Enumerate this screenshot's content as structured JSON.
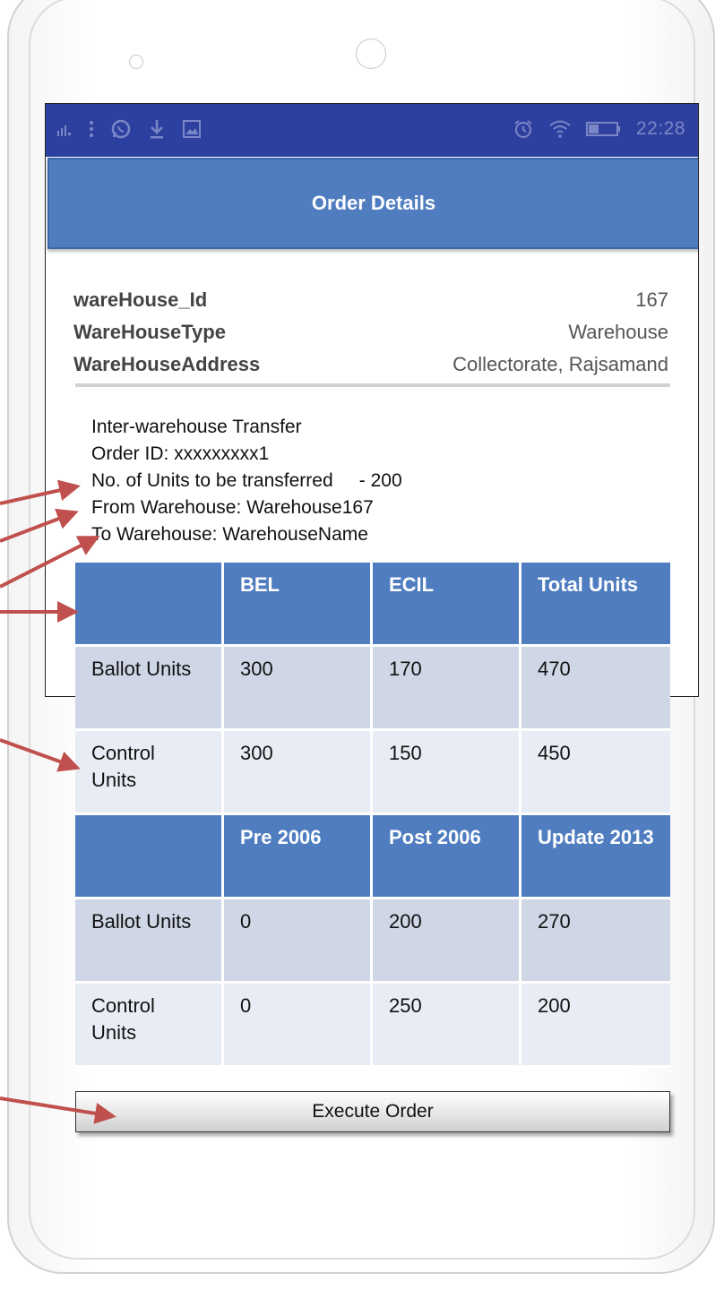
{
  "status_bar": {
    "time": "22:28",
    "left_icons": [
      "signal-icon",
      "more-icon",
      "whatsapp-icon",
      "download-icon",
      "image-icon"
    ],
    "right_icons": [
      "alarm-icon",
      "wifi-icon",
      "battery-icon"
    ],
    "color": "#2e409f"
  },
  "app_bar": {
    "title": "Order Details",
    "color": "#4f7dc0"
  },
  "warehouse": {
    "rows": [
      {
        "label": "wareHouse_Id",
        "value": "167"
      },
      {
        "label": "WareHouseType",
        "value": "Warehouse"
      },
      {
        "label": "WareHouseAddress",
        "value": "Collectorate, Rajsamand"
      }
    ]
  },
  "order": {
    "type": "Inter-warehouse Transfer",
    "order_id": "Order ID: xxxxxxxxx1",
    "units_line": "No. of Units to be transferred     - 200",
    "from_line": "From Warehouse: Warehouse167",
    "to_line": "To Warehouse: WarehouseName"
  },
  "table_manufacturer": {
    "headers": [
      "",
      "BEL",
      "ECIL",
      "Total Units"
    ],
    "rows": [
      [
        "Ballot Units",
        "300",
        "170",
        "470"
      ],
      [
        "Control Units",
        "300",
        "150",
        "450"
      ]
    ]
  },
  "table_version": {
    "headers": [
      "",
      "Pre 2006",
      "Post 2006",
      "Update 2013"
    ],
    "rows": [
      [
        "Ballot Units",
        "0",
        "200",
        "270"
      ],
      [
        "Control Units",
        "0",
        "250",
        "200"
      ]
    ]
  },
  "actions": {
    "execute_label": "Execute Order"
  },
  "colors": {
    "header_cell": "#4f7dc0",
    "row_odd": "#cfd6e6",
    "row_even": "#e8ecf4",
    "arrow": "#c0504d"
  }
}
